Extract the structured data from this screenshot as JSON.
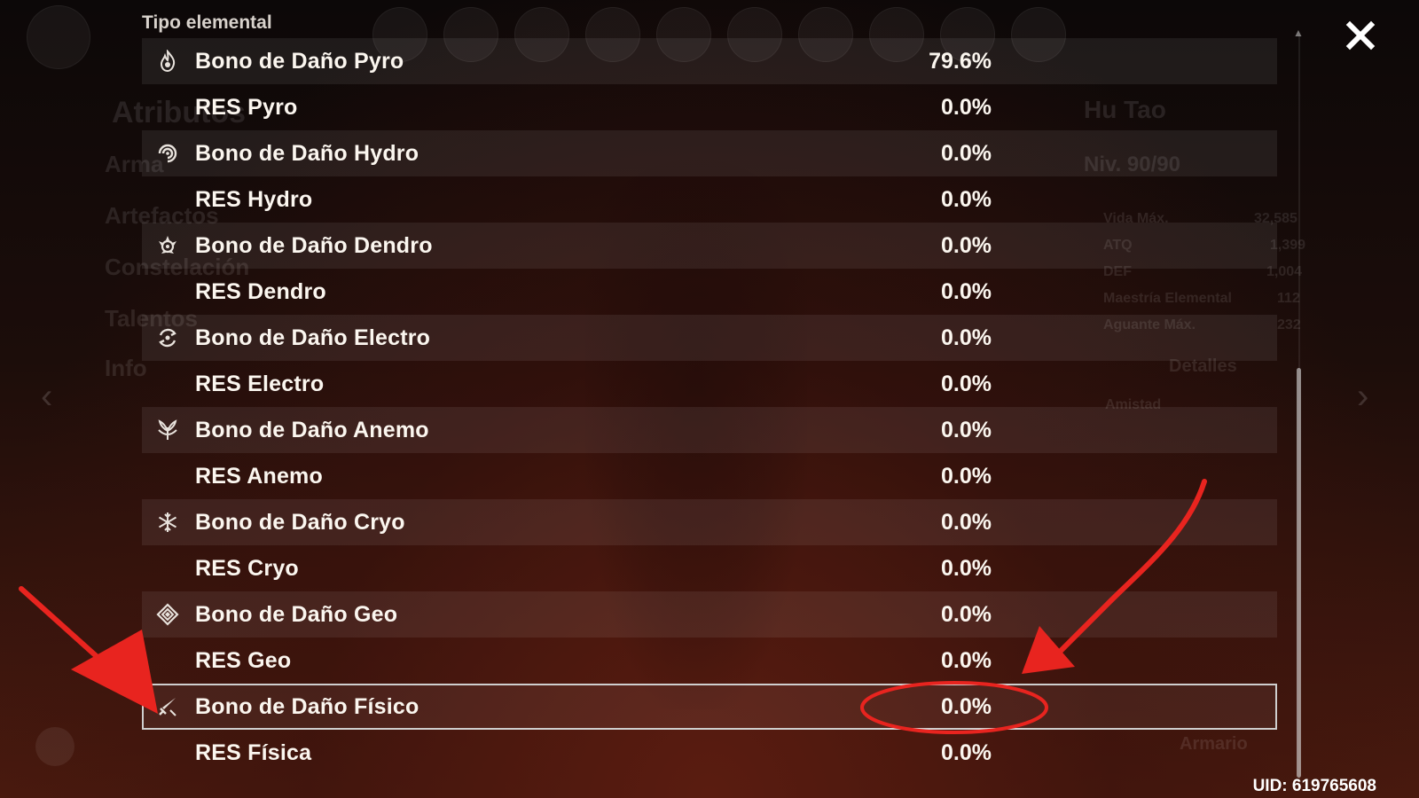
{
  "header": {
    "section_title": "Tipo elemental",
    "close_icon": "close-icon"
  },
  "background": {
    "character_name": "Hu Tao",
    "level": "Niv. 90/90",
    "side_menu": [
      "Atributos",
      "Arma",
      "Artefactos",
      "Constelación",
      "Talentos",
      "Info"
    ],
    "stats": [
      {
        "label": "Vida Máx.",
        "value": "32,585"
      },
      {
        "label": "ATQ",
        "value": "1,399"
      },
      {
        "label": "DEF",
        "value": "1,004"
      },
      {
        "label": "Maestría Elemental",
        "value": "112"
      },
      {
        "label": "Aguante Máx.",
        "value": "232"
      }
    ],
    "details_button": "Detalles",
    "friendship_label": "Amistad",
    "wardrobe_button": "Armario"
  },
  "rows": [
    {
      "label": "Bono de Daño Pyro",
      "value": "79.6%",
      "icon": "pyro-icon"
    },
    {
      "label": "RES Pyro",
      "value": "0.0%"
    },
    {
      "label": "Bono de Daño Hydro",
      "value": "0.0%",
      "icon": "hydro-icon"
    },
    {
      "label": "RES Hydro",
      "value": "0.0%"
    },
    {
      "label": "Bono de Daño Dendro",
      "value": "0.0%",
      "icon": "dendro-icon"
    },
    {
      "label": "RES Dendro",
      "value": "0.0%"
    },
    {
      "label": "Bono de Daño Electro",
      "value": "0.0%",
      "icon": "electro-icon"
    },
    {
      "label": "RES Electro",
      "value": "0.0%"
    },
    {
      "label": "Bono de Daño Anemo",
      "value": "0.0%",
      "icon": "anemo-icon"
    },
    {
      "label": "RES Anemo",
      "value": "0.0%"
    },
    {
      "label": "Bono de Daño Cryo",
      "value": "0.0%",
      "icon": "cryo-icon"
    },
    {
      "label": "RES Cryo",
      "value": "0.0%"
    },
    {
      "label": "Bono de Daño Geo",
      "value": "0.0%",
      "icon": "geo-icon"
    },
    {
      "label": "RES Geo",
      "value": "0.0%"
    },
    {
      "label": "Bono de Daño Físico",
      "value": "0.0%",
      "icon": "physical-icon"
    },
    {
      "label": "RES Física",
      "value": "0.0%"
    }
  ],
  "footer": {
    "uid": "UID: 619765608"
  },
  "colors": {
    "annotation_red": "#e8241f",
    "row_shade": "#2a1a16",
    "highlight_border": "#cfcfcf"
  }
}
